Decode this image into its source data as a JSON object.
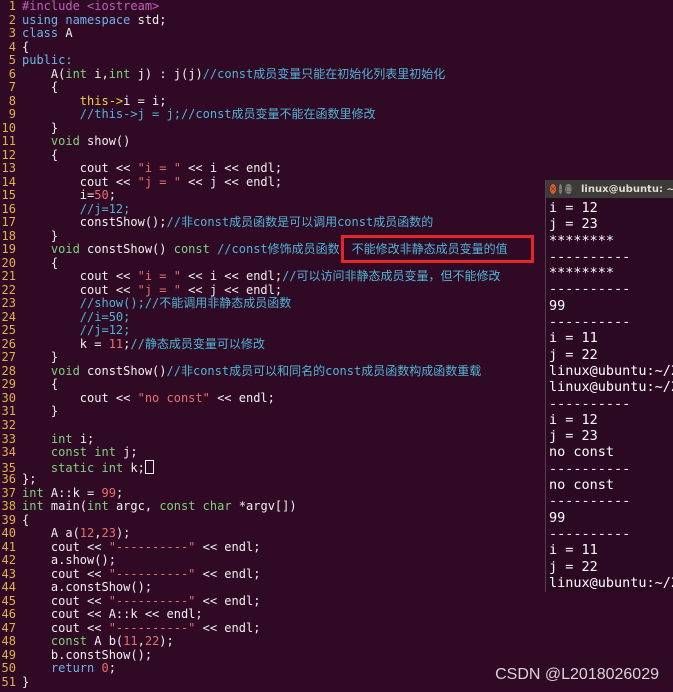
{
  "editor": {
    "lines": [
      {
        "n": "1",
        "tokens": [
          {
            "t": "#include <iostream>",
            "c": "pre"
          }
        ]
      },
      {
        "n": "2",
        "tokens": [
          {
            "t": "using namespace",
            "c": "kw"
          },
          {
            "t": " std;",
            "c": ""
          }
        ]
      },
      {
        "n": "3",
        "tokens": [
          {
            "t": "class",
            "c": "kw"
          },
          {
            "t": " A",
            "c": ""
          }
        ]
      },
      {
        "n": "4",
        "tokens": [
          {
            "t": "{",
            "c": ""
          }
        ]
      },
      {
        "n": "5",
        "tokens": [
          {
            "t": "public:",
            "c": "kw"
          }
        ]
      },
      {
        "n": "6",
        "tokens": [
          {
            "t": "    A(",
            "c": ""
          },
          {
            "t": "int",
            "c": "type"
          },
          {
            "t": " i,",
            "c": ""
          },
          {
            "t": "int",
            "c": "type"
          },
          {
            "t": " j) : j(j)",
            "c": ""
          },
          {
            "t": "//const成员变量只能在初始化列表里初始化",
            "c": "com"
          }
        ]
      },
      {
        "n": "7",
        "tokens": [
          {
            "t": "    {",
            "c": ""
          }
        ]
      },
      {
        "n": "8",
        "tokens": [
          {
            "t": "        ",
            "c": ""
          },
          {
            "t": "this->",
            "c": "acc"
          },
          {
            "t": "i = i;",
            "c": ""
          }
        ]
      },
      {
        "n": "9",
        "tokens": [
          {
            "t": "        //this->j = j;//const成员变量不能在函数里修改",
            "c": "com"
          }
        ]
      },
      {
        "n": "10",
        "tokens": [
          {
            "t": "    }",
            "c": ""
          }
        ]
      },
      {
        "n": "11",
        "tokens": [
          {
            "t": "    ",
            "c": ""
          },
          {
            "t": "void",
            "c": "type"
          },
          {
            "t": " show()",
            "c": ""
          }
        ]
      },
      {
        "n": "12",
        "tokens": [
          {
            "t": "    {",
            "c": ""
          }
        ]
      },
      {
        "n": "13",
        "tokens": [
          {
            "t": "        cout << ",
            "c": ""
          },
          {
            "t": "\"i = \"",
            "c": "str"
          },
          {
            "t": " << i << endl;",
            "c": ""
          }
        ]
      },
      {
        "n": "14",
        "tokens": [
          {
            "t": "        cout << ",
            "c": ""
          },
          {
            "t": "\"j = \"",
            "c": "str"
          },
          {
            "t": " << j << endl;",
            "c": ""
          }
        ]
      },
      {
        "n": "15",
        "tokens": [
          {
            "t": "        i=",
            "c": ""
          },
          {
            "t": "50",
            "c": "num"
          },
          {
            "t": ";",
            "c": ""
          }
        ]
      },
      {
        "n": "16",
        "tokens": [
          {
            "t": "        //j=12;",
            "c": "com"
          }
        ]
      },
      {
        "n": "17",
        "tokens": [
          {
            "t": "        constShow();",
            "c": ""
          },
          {
            "t": "//非const成员函数是可以调用const成员函数的",
            "c": "com"
          }
        ]
      },
      {
        "n": "18",
        "tokens": [
          {
            "t": "    }",
            "c": ""
          }
        ]
      },
      {
        "n": "19",
        "tokens": [
          {
            "t": "    ",
            "c": ""
          },
          {
            "t": "void",
            "c": "type"
          },
          {
            "t": " constShow() ",
            "c": ""
          },
          {
            "t": "const",
            "c": "type"
          },
          {
            "t": " //const修饰成员函数，不能修改非静态成员变量的值",
            "c": "com"
          }
        ]
      },
      {
        "n": "20",
        "tokens": [
          {
            "t": "    {",
            "c": ""
          }
        ]
      },
      {
        "n": "21",
        "tokens": [
          {
            "t": "        cout << ",
            "c": ""
          },
          {
            "t": "\"i = \"",
            "c": "str"
          },
          {
            "t": " << i << endl;",
            "c": ""
          },
          {
            "t": "//可以访问非静态成员变量，但不能修改",
            "c": "com"
          }
        ]
      },
      {
        "n": "22",
        "tokens": [
          {
            "t": "        cout << ",
            "c": ""
          },
          {
            "t": "\"j = \"",
            "c": "str"
          },
          {
            "t": " << j << endl;",
            "c": ""
          }
        ]
      },
      {
        "n": "23",
        "tokens": [
          {
            "t": "        //show();//不能调用非静态成员函数",
            "c": "com"
          }
        ]
      },
      {
        "n": "24",
        "tokens": [
          {
            "t": "        //i=50;",
            "c": "com"
          }
        ]
      },
      {
        "n": "25",
        "tokens": [
          {
            "t": "        //j=12;",
            "c": "com"
          }
        ]
      },
      {
        "n": "26",
        "tokens": [
          {
            "t": "        k = ",
            "c": ""
          },
          {
            "t": "11",
            "c": "num"
          },
          {
            "t": ";",
            "c": ""
          },
          {
            "t": "//静态成员变量可以修改",
            "c": "com"
          }
        ]
      },
      {
        "n": "27",
        "tokens": [
          {
            "t": "    }",
            "c": ""
          }
        ]
      },
      {
        "n": "28",
        "tokens": [
          {
            "t": "    ",
            "c": ""
          },
          {
            "t": "void",
            "c": "type"
          },
          {
            "t": " constShow()",
            "c": ""
          },
          {
            "t": "//非const成员可以和同名的const成员函数构成函数重载",
            "c": "com"
          }
        ]
      },
      {
        "n": "29",
        "tokens": [
          {
            "t": "    {",
            "c": ""
          }
        ]
      },
      {
        "n": "30",
        "tokens": [
          {
            "t": "        cout << ",
            "c": ""
          },
          {
            "t": "\"no const\"",
            "c": "str"
          },
          {
            "t": " << endl;",
            "c": ""
          }
        ]
      },
      {
        "n": "31",
        "tokens": [
          {
            "t": "    }",
            "c": ""
          }
        ]
      },
      {
        "n": "32",
        "tokens": [
          {
            "t": "",
            "c": ""
          }
        ]
      },
      {
        "n": "33",
        "tokens": [
          {
            "t": "    ",
            "c": ""
          },
          {
            "t": "int",
            "c": "type"
          },
          {
            "t": " i;",
            "c": ""
          }
        ]
      },
      {
        "n": "34",
        "tokens": [
          {
            "t": "    ",
            "c": ""
          },
          {
            "t": "const",
            "c": "type"
          },
          {
            "t": " ",
            "c": ""
          },
          {
            "t": "int",
            "c": "type"
          },
          {
            "t": " j;",
            "c": ""
          }
        ]
      },
      {
        "n": "35",
        "tokens": [
          {
            "t": "    ",
            "c": ""
          },
          {
            "t": "static",
            "c": "type"
          },
          {
            "t": " ",
            "c": ""
          },
          {
            "t": "int",
            "c": "type"
          },
          {
            "t": " k;",
            "c": ""
          }
        ],
        "cursor": true
      },
      {
        "n": "36",
        "tokens": [
          {
            "t": "};",
            "c": ""
          }
        ]
      },
      {
        "n": "37",
        "tokens": [
          {
            "t": "int",
            "c": "type"
          },
          {
            "t": " A::k = ",
            "c": ""
          },
          {
            "t": "99",
            "c": "num"
          },
          {
            "t": ";",
            "c": ""
          }
        ]
      },
      {
        "n": "38",
        "tokens": [
          {
            "t": "int",
            "c": "type"
          },
          {
            "t": " main(",
            "c": ""
          },
          {
            "t": "int",
            "c": "type"
          },
          {
            "t": " argc, ",
            "c": ""
          },
          {
            "t": "const",
            "c": "type"
          },
          {
            "t": " ",
            "c": ""
          },
          {
            "t": "char",
            "c": "type"
          },
          {
            "t": " *argv[])",
            "c": ""
          }
        ]
      },
      {
        "n": "39",
        "tokens": [
          {
            "t": "{",
            "c": ""
          }
        ]
      },
      {
        "n": "40",
        "tokens": [
          {
            "t": "    A a(",
            "c": ""
          },
          {
            "t": "12",
            "c": "num"
          },
          {
            "t": ",",
            "c": ""
          },
          {
            "t": "23",
            "c": "num"
          },
          {
            "t": ");",
            "c": ""
          }
        ]
      },
      {
        "n": "41",
        "tokens": [
          {
            "t": "    cout << ",
            "c": ""
          },
          {
            "t": "\"----------\"",
            "c": "str"
          },
          {
            "t": " << endl;",
            "c": ""
          }
        ]
      },
      {
        "n": "42",
        "tokens": [
          {
            "t": "    a.show();",
            "c": ""
          }
        ]
      },
      {
        "n": "43",
        "tokens": [
          {
            "t": "    cout << ",
            "c": ""
          },
          {
            "t": "\"----------\"",
            "c": "str"
          },
          {
            "t": " << endl;",
            "c": ""
          }
        ]
      },
      {
        "n": "44",
        "tokens": [
          {
            "t": "    a.constShow();",
            "c": ""
          }
        ]
      },
      {
        "n": "45",
        "tokens": [
          {
            "t": "    cout << ",
            "c": ""
          },
          {
            "t": "\"----------\"",
            "c": "str"
          },
          {
            "t": " << endl;",
            "c": ""
          }
        ]
      },
      {
        "n": "46",
        "tokens": [
          {
            "t": "    cout << A::k << endl;",
            "c": ""
          }
        ]
      },
      {
        "n": "47",
        "tokens": [
          {
            "t": "    cout << ",
            "c": ""
          },
          {
            "t": "\"----------\"",
            "c": "str"
          },
          {
            "t": " << endl;",
            "c": ""
          }
        ]
      },
      {
        "n": "48",
        "tokens": [
          {
            "t": "    ",
            "c": ""
          },
          {
            "t": "const",
            "c": "type"
          },
          {
            "t": " A b(",
            "c": ""
          },
          {
            "t": "11",
            "c": "num"
          },
          {
            "t": ",",
            "c": ""
          },
          {
            "t": "22",
            "c": "num"
          },
          {
            "t": ");",
            "c": ""
          }
        ]
      },
      {
        "n": "49",
        "tokens": [
          {
            "t": "    b.constShow();",
            "c": ""
          }
        ]
      },
      {
        "n": "50",
        "tokens": [
          {
            "t": "    ",
            "c": ""
          },
          {
            "t": "return",
            "c": "kw"
          },
          {
            "t": " ",
            "c": ""
          },
          {
            "t": "0",
            "c": "num"
          },
          {
            "t": ";",
            "c": ""
          }
        ]
      },
      {
        "n": "51",
        "tokens": [
          {
            "t": "}",
            "c": ""
          }
        ]
      }
    ]
  },
  "terminal": {
    "title": "linux@ubuntu: ~",
    "lines": [
      "i = 12",
      "j = 23",
      "********",
      "----------",
      "********",
      "----------",
      "99",
      "----------",
      "i = 11",
      "j = 22",
      "linux@ubuntu:~/2",
      "linux@ubuntu:~/2",
      "----------",
      "i = 12",
      "j = 23",
      "no const",
      "----------",
      "no const",
      "----------",
      "99",
      "----------",
      "i = 11",
      "j = 22",
      "linux@ubuntu:~/2"
    ]
  },
  "watermark": "CSDN @L2018026029",
  "colors": {
    "background": "#300a24",
    "line_number": "#e3b24c",
    "comment": "#4fb5d6",
    "string": "#e86f6f",
    "type": "#7fd27f",
    "highlight_box": "#e32727"
  }
}
